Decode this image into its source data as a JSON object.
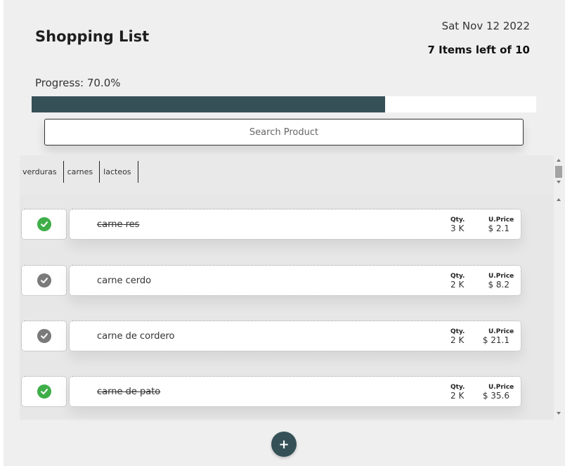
{
  "header": {
    "title": "Shopping List",
    "date": "Sat Nov 12 2022",
    "items_left": "7 Items left of 10"
  },
  "progress": {
    "label": "Progress: 70.0%",
    "value": 0.7
  },
  "search": {
    "placeholder": "Search Product"
  },
  "categories": [
    "verduras",
    "carnes",
    "lacteos"
  ],
  "list_headers": {
    "qty": "Qty.",
    "price": "U.Price"
  },
  "items": [
    {
      "name": "carne res",
      "qty": "3 K",
      "price": "$ 2.1",
      "done": true
    },
    {
      "name": "carne cerdo",
      "qty": "2 K",
      "price": "$ 8.2",
      "done": false
    },
    {
      "name": "carne de cordero",
      "qty": "2 K",
      "price": "$ 21.1",
      "done": false
    },
    {
      "name": "carne de pato",
      "qty": "2 K",
      "price": "$ 35.6",
      "done": true
    }
  ],
  "add_button": "+",
  "colors": {
    "accent": "#355157",
    "done_check": "#3fae49",
    "pending_check": "#7a7a7a",
    "panel": "#efefef"
  },
  "icons": {
    "done": "check-circle-icon",
    "pending": "check-circle-icon"
  }
}
